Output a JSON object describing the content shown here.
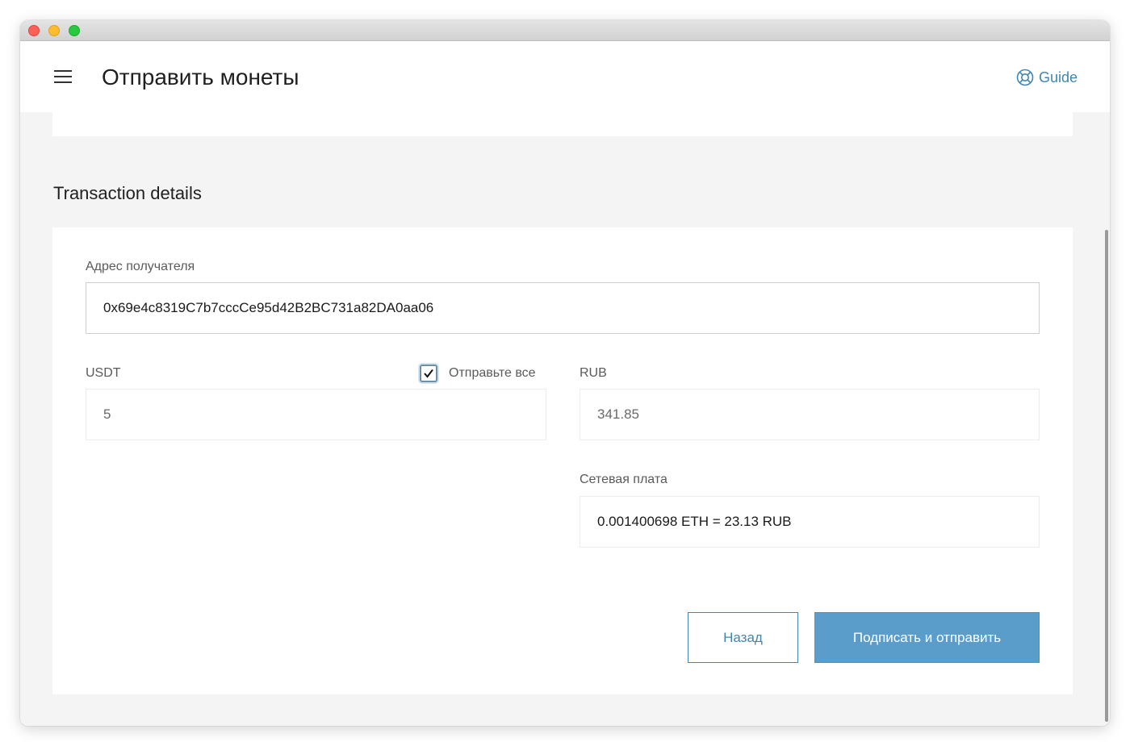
{
  "window": {
    "controls": [
      "close",
      "minimize",
      "zoom"
    ]
  },
  "header": {
    "menu_icon": "hamburger-menu-icon",
    "title": "Отправить монеты",
    "guide": {
      "icon": "lifebuoy-icon",
      "label": "Guide"
    }
  },
  "section": {
    "title": "Transaction details"
  },
  "form": {
    "recipient": {
      "label": "Адрес получателя",
      "value": "0x69e4c8319C7b7cccCe95d42B2BC731a82DA0aa06"
    },
    "amount": {
      "label": "USDT",
      "value": "5"
    },
    "send_all": {
      "label": "Отправьте все",
      "checked": true
    },
    "fiat": {
      "label": "RUB",
      "value": "341.85"
    },
    "fee": {
      "label": "Сетевая плата",
      "value": "0.001400698 ETH = 23.13 RUB"
    }
  },
  "actions": {
    "back_label": "Назад",
    "submit_label": "Подписать и отправить"
  },
  "colors": {
    "accent": "#3f86b3",
    "primary_button": "#5a9dcb",
    "page_background": "#f4f4f4",
    "card_background": "#ffffff"
  }
}
